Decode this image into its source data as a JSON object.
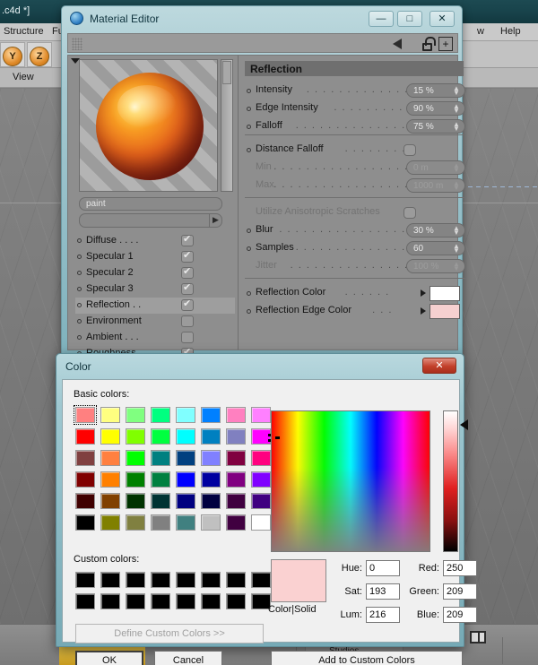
{
  "background_app": {
    "title": ".c4d *]",
    "menus": [
      "Structure",
      "Fu",
      "w",
      "Help"
    ],
    "toolbar_axes": [
      "Y",
      "Z"
    ],
    "viewport_label": "View",
    "taskbar_item": "Studios"
  },
  "material_editor": {
    "title": "Material Editor",
    "icon": "sphere-icon",
    "window_buttons": {
      "minimize": "—",
      "maximize": "□",
      "close": "✕"
    },
    "toolbar": {
      "grip": "grip-icon",
      "back_arrow": "◀",
      "lock": "lock-icon",
      "add": "+"
    },
    "material_name": "paint",
    "channels": [
      {
        "label": "Diffuse",
        "dots": ". . . .",
        "checked": true
      },
      {
        "label": "Specular 1",
        "dots": "",
        "checked": true
      },
      {
        "label": "Specular 2",
        "dots": "",
        "checked": true
      },
      {
        "label": "Specular 3",
        "dots": "",
        "checked": true
      },
      {
        "label": "Reflection",
        "dots": ". .",
        "checked": true,
        "selected": true
      },
      {
        "label": "Environment",
        "dots": "",
        "checked": false
      },
      {
        "label": "Ambient",
        "dots": ". . .",
        "checked": false
      },
      {
        "label": "Roughness",
        "dots": "",
        "checked": true
      }
    ],
    "section_title": "Reflection",
    "properties": [
      {
        "label": "Intensity",
        "value": "15 %",
        "type": "number",
        "enabled": true
      },
      {
        "label": "Edge Intensity",
        "value": "90 %",
        "type": "number",
        "enabled": true
      },
      {
        "label": "Falloff",
        "value": "75 %",
        "type": "number",
        "enabled": true
      },
      {
        "label": "Distance Falloff",
        "value": "",
        "type": "toggle",
        "enabled": true
      },
      {
        "label": "Min",
        "value": "0 m",
        "type": "number",
        "enabled": false
      },
      {
        "label": "Max",
        "value": "1000 m",
        "type": "number",
        "enabled": false
      },
      {
        "label": "Utilize Anisotropic Scratches",
        "value": "",
        "type": "toggle",
        "enabled": false
      },
      {
        "label": "Blur",
        "value": "30 %",
        "type": "number",
        "enabled": true
      },
      {
        "label": "Samples",
        "value": "60",
        "type": "number",
        "enabled": true
      },
      {
        "label": "Jitter",
        "value": "100 %",
        "type": "number",
        "enabled": false
      },
      {
        "label": "Reflection Color",
        "value": "#ffffff",
        "type": "color",
        "enabled": true
      },
      {
        "label": "Reflection Edge Color",
        "value": "#f6d0d0",
        "type": "color",
        "enabled": true
      }
    ]
  },
  "color_dialog": {
    "title": "Color",
    "close_label": "✕",
    "basic_colors_label": "Basic colors:",
    "custom_colors_label": "Custom colors:",
    "basic_colors": [
      "#ff8080",
      "#ffff80",
      "#80ff80",
      "#00ff80",
      "#80ffff",
      "#0080ff",
      "#ff80c0",
      "#ff80ff",
      "#ff0000",
      "#ffff00",
      "#80ff00",
      "#00ff40",
      "#00ffff",
      "#0080c0",
      "#8080c0",
      "#ff00ff",
      "#804040",
      "#ff8040",
      "#00ff00",
      "#008080",
      "#004080",
      "#8080ff",
      "#800040",
      "#ff0080",
      "#800000",
      "#ff8000",
      "#008000",
      "#008040",
      "#0000ff",
      "#0000a0",
      "#800080",
      "#8000ff",
      "#400000",
      "#804000",
      "#003300",
      "#003333",
      "#000080",
      "#000040",
      "#400040",
      "#400080",
      "#000000",
      "#808000",
      "#808040",
      "#808080",
      "#408080",
      "#c0c0c0",
      "#400040",
      "#ffffff"
    ],
    "selected_basic_index": 0,
    "custom_colors": [
      "#000000",
      "#000000",
      "#000000",
      "#000000",
      "#000000",
      "#000000",
      "#000000",
      "#000000",
      "#000000",
      "#000000",
      "#000000",
      "#000000",
      "#000000",
      "#000000",
      "#000000",
      "#000000"
    ],
    "preview_color": "#fad1d1",
    "preview_label": "Color|Solid",
    "fields": {
      "hue_label": "Hue:",
      "hue_value": "0",
      "sat_label": "Sat:",
      "sat_value": "193",
      "lum_label": "Lum:",
      "lum_value": "216",
      "red_label": "Red:",
      "red_value": "250",
      "green_label": "Green:",
      "green_value": "209",
      "blue_label": "Blue:",
      "blue_value": "209"
    },
    "buttons": {
      "define": "Define Custom Colors >>",
      "ok": "OK",
      "cancel": "Cancel",
      "add": "Add to Custom Colors"
    }
  }
}
